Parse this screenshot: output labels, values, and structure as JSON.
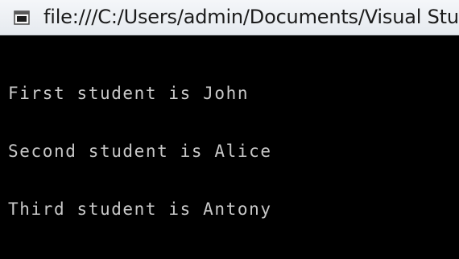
{
  "window": {
    "title": "file:///C:/Users/admin/Documents/Visual Studio"
  },
  "icons": {
    "app": "console-window-icon"
  },
  "colors": {
    "console_background": "#000000",
    "console_text": "#c8c8c8",
    "titlebar_background": "#eef1f5"
  },
  "console": {
    "lines": [
      "First student is John",
      "Second student is Alice",
      "Third student is Antony"
    ]
  }
}
